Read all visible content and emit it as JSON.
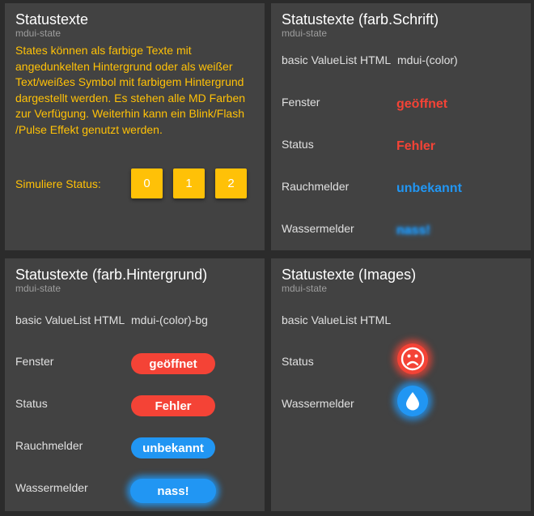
{
  "colors": {
    "amber": "#ffc107",
    "red": "#f44336",
    "blue": "#2196f3"
  },
  "card1": {
    "title": "Statustexte",
    "subtitle": "mdui-state",
    "description": "States können als farbige Texte mit angedunkelten Hintergrund oder als weißer Text/weißes Symbol mit farbigem Hintergrund dargestellt werden. Es stehen alle MD Farben zur Verfügung. Weiterhin kann ein Blink/Flash /Pulse Effekt genutzt werden.",
    "simulate_label": "Simuliere Status:",
    "buttons": [
      "0",
      "1",
      "2"
    ]
  },
  "card2": {
    "title": "Statustexte (farb.Schrift)",
    "subtitle": "mdui-state",
    "header_left": "basic ValueList HTML",
    "header_right": "mdui-(color)",
    "rows": [
      {
        "label": "Fenster",
        "value": "geöffnet"
      },
      {
        "label": "Status",
        "value": "Fehler"
      },
      {
        "label": "Rauchmelder",
        "value": "unbekannt"
      },
      {
        "label": "Wassermelder",
        "value": "nass!"
      }
    ]
  },
  "card3": {
    "title": "Statustexte (farb.Hintergrund)",
    "subtitle": "mdui-state",
    "header_left": "basic ValueList HTML",
    "header_right": "mdui-(color)-bg",
    "rows": [
      {
        "label": "Fenster",
        "value": "geöffnet"
      },
      {
        "label": "Status",
        "value": "Fehler"
      },
      {
        "label": "Rauchmelder",
        "value": "unbekannt"
      },
      {
        "label": "Wassermelder",
        "value": "nass!"
      }
    ]
  },
  "card4": {
    "title": "Statustexte (Images)",
    "subtitle": "mdui-state",
    "header_left": "basic ValueList HTML",
    "rows": [
      {
        "label": "Status",
        "icon": "sad-face-icon"
      },
      {
        "label": "Wassermelder",
        "icon": "water-drop-icon"
      }
    ]
  }
}
